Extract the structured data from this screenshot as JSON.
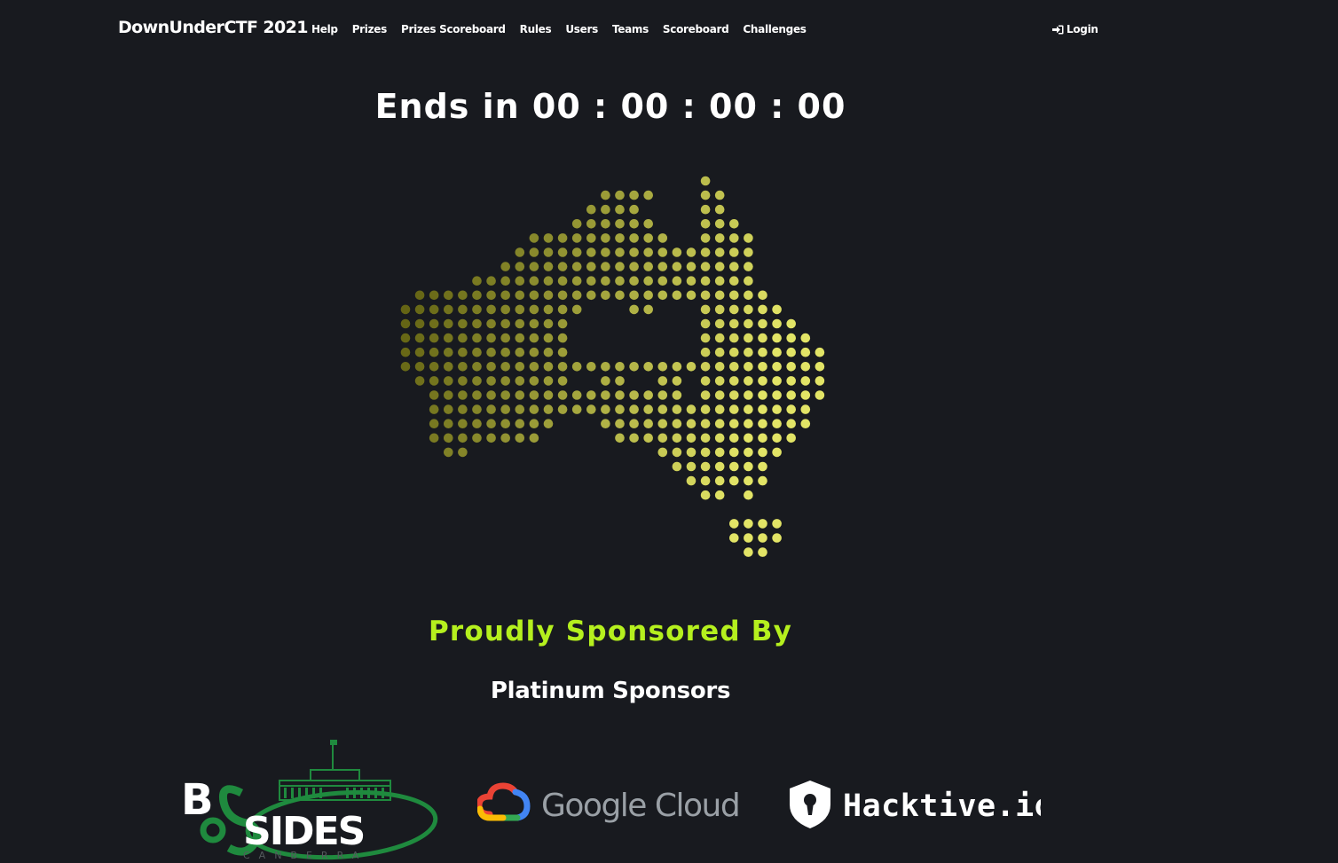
{
  "nav": {
    "brand": "DownUnderCTF 2021",
    "links": [
      "Help",
      "Prizes",
      "Prizes Scoreboard",
      "Rules",
      "Users",
      "Teams",
      "Scoreboard",
      "Challenges"
    ],
    "login": "Login"
  },
  "countdown": {
    "prefix": "Ends in",
    "text": "Ends in 00 : 00 : 00 : 00"
  },
  "map": {
    "description_icon": "australia-dot-map",
    "colors": {
      "west": "#6d6b12",
      "east": "#dde05f"
    }
  },
  "sponsors": {
    "heading": "Proudly Sponsored By",
    "tier": "Platinum Sponsors",
    "logos": [
      {
        "name": "bsides-canberra-logo",
        "text_main": "SIDES",
        "text_sub": "CANBERRA",
        "letter": "B"
      },
      {
        "name": "google-cloud-logo",
        "text": "Google Cloud"
      },
      {
        "name": "hacktive-logo",
        "text": "Hacktive.io"
      }
    ]
  },
  "colors": {
    "background": "#181a1f",
    "accent": "#b5f01e",
    "bsides_green": "#1f8a3e"
  }
}
